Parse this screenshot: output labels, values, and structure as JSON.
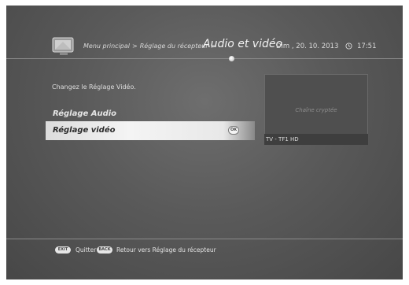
{
  "header": {
    "breadcrumb": [
      "Menu principal",
      "Réglage du récepteur"
    ],
    "separator": ">",
    "current_page": "Audio et vidéo",
    "date": "Dim , 20. 10. 2013",
    "time": "17:51"
  },
  "menu": {
    "caption": "Changez le Réglage Vidéo.",
    "items": [
      {
        "label": "Réglage Audio",
        "selected": false
      },
      {
        "label": "Réglage vidéo",
        "selected": true
      }
    ],
    "ok_badge": "OK"
  },
  "preview": {
    "message": "Chaîne cryptée",
    "channel": "TV - TF1 HD"
  },
  "footer": {
    "exit_key": "EXIT",
    "exit_label": "Quitter",
    "back_key": "BACK",
    "back_label": "Retour vers Réglage du récepteur"
  },
  "icons": {
    "tv": "tv-icon",
    "clock": "clock-icon"
  },
  "colors": {
    "background": "#5a5a5a",
    "highlight": "#ececec"
  }
}
